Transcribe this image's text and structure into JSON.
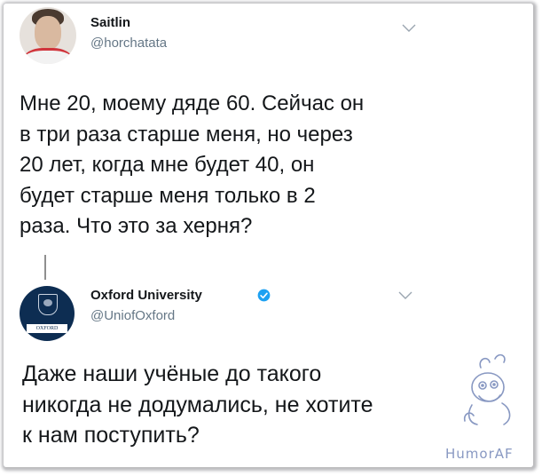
{
  "tweet1": {
    "name": "Saitlin",
    "handle": "@horchatata",
    "text": "Мне 20, моему дяде 60. Сейчас он\nв три раза старше меня, но через\n20 лет, когда мне будет 40, он\nбудет старше меня только в 2\nраза. Что это за херня?",
    "avatar_icon": "user-photo",
    "menu_icon": "chevron-down-icon"
  },
  "tweet2": {
    "name": "Oxford University",
    "handle": "@UniofOxford",
    "verified_icon": "verified-badge-icon",
    "avatar_caption": "OXFORD",
    "text": "Даже наши учёные до такого\nникогда не додумались, не хотите\nк нам поступить?",
    "menu_icon": "chevron-down-icon"
  },
  "watermark": {
    "text": "HumorAF"
  },
  "colors": {
    "text": "#14171a",
    "handle": "#657786",
    "verified": "#1da1f2",
    "oxford_blue": "#0d2d52",
    "watermark": "#8898c2"
  }
}
